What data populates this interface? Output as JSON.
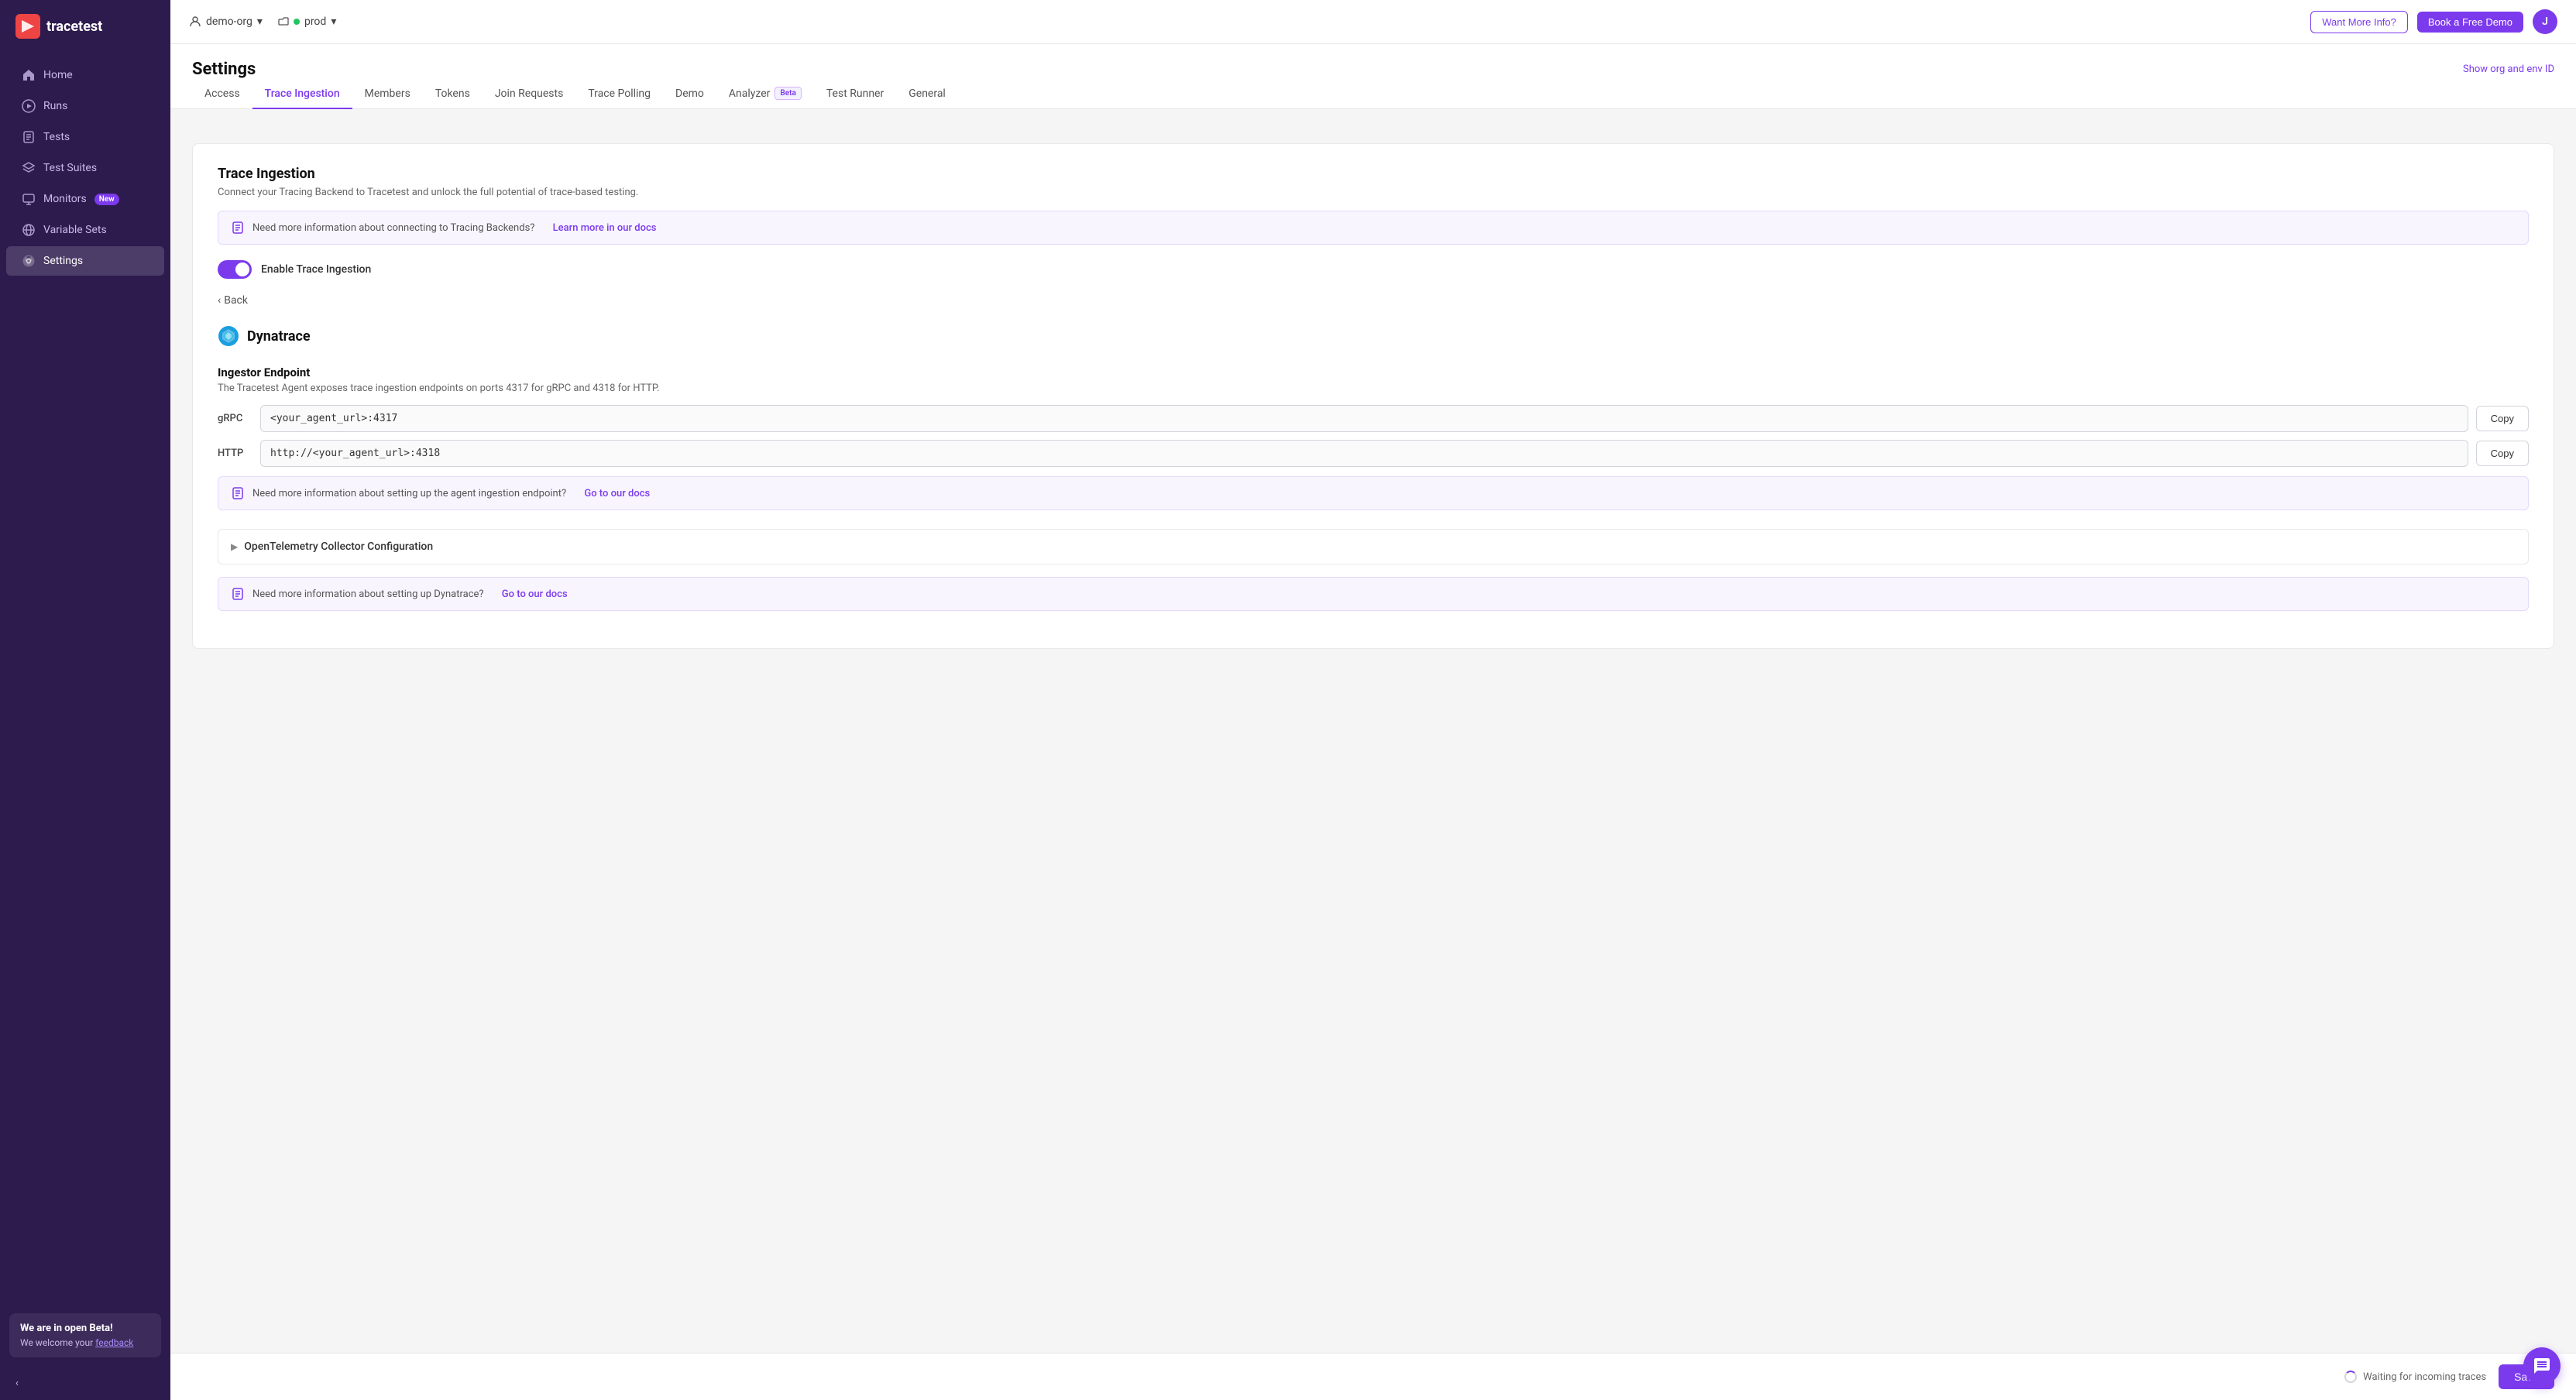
{
  "app": {
    "name": "tracetest"
  },
  "topbar": {
    "org": "demo-org",
    "env": "prod",
    "env_status": "live",
    "want_more_info": "Want More Info?",
    "book_free_demo": "Book a Free Demo",
    "user_initial": "J"
  },
  "header": {
    "title": "Settings",
    "show_ids_link": "Show org and env ID"
  },
  "tabs": [
    {
      "id": "access",
      "label": "Access",
      "active": false
    },
    {
      "id": "trace-ingestion",
      "label": "Trace Ingestion",
      "active": true
    },
    {
      "id": "members",
      "label": "Members",
      "active": false
    },
    {
      "id": "tokens",
      "label": "Tokens",
      "active": false
    },
    {
      "id": "join-requests",
      "label": "Join Requests",
      "active": false
    },
    {
      "id": "trace-polling",
      "label": "Trace Polling",
      "active": false
    },
    {
      "id": "demo",
      "label": "Demo",
      "active": false
    },
    {
      "id": "analyzer",
      "label": "Analyzer",
      "active": false,
      "badge": "Beta"
    },
    {
      "id": "test-runner",
      "label": "Test Runner",
      "active": false
    },
    {
      "id": "general",
      "label": "General",
      "active": false
    }
  ],
  "trace_ingestion": {
    "section_title": "Trace Ingestion",
    "section_desc": "Connect your Tracing Backend to Tracetest and unlock the full potential of trace-based testing.",
    "info_box_text": "Need more information about connecting to Tracing Backends?",
    "info_box_link": "Learn more in our docs",
    "toggle_label": "Enable Trace Ingestion",
    "toggle_enabled": true,
    "back_label": "Back",
    "provider_name": "Dynatrace",
    "ingestor": {
      "title": "Ingestor Endpoint",
      "desc": "The Tracetest Agent exposes trace ingestion endpoints on ports 4317 for gRPC and 4318 for HTTP.",
      "grpc_label": "gRPC",
      "grpc_value": "<your_agent_url>:4317",
      "http_label": "HTTP",
      "http_value": "http://<your_agent_url>:4318",
      "copy_label": "Copy"
    },
    "endpoint_info_text": "Need more information about setting up the agent ingestion endpoint?",
    "endpoint_info_link": "Go to our docs",
    "collector_section": "OpenTelemetry Collector Configuration",
    "dynatrace_info_text": "Need more information about setting up Dynatrace?",
    "dynatrace_info_link": "Go to our docs"
  },
  "sidebar": {
    "items": [
      {
        "id": "home",
        "label": "Home",
        "icon": "home"
      },
      {
        "id": "runs",
        "label": "Runs",
        "icon": "play"
      },
      {
        "id": "tests",
        "label": "Tests",
        "icon": "test"
      },
      {
        "id": "test-suites",
        "label": "Test Suites",
        "icon": "layers"
      },
      {
        "id": "monitors",
        "label": "Monitors",
        "icon": "monitor",
        "badge": "New"
      },
      {
        "id": "variable-sets",
        "label": "Variable Sets",
        "icon": "globe"
      },
      {
        "id": "settings",
        "label": "Settings",
        "icon": "gear",
        "active": true
      }
    ],
    "beta_title": "We are in open Beta!",
    "beta_desc": "We welcome your ",
    "beta_link": "feedback",
    "collapse_label": "<"
  },
  "footer": {
    "waiting_text": "Waiting for incoming traces",
    "save_label": "Save"
  }
}
